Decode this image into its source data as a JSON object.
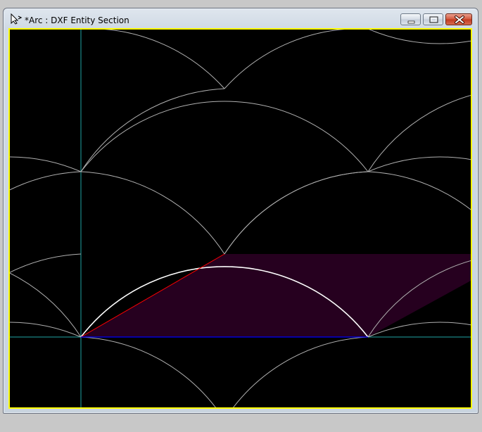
{
  "window": {
    "title": "*Arc : DXF Entity Section"
  },
  "icons": {
    "app": "cursor-arrow-icon",
    "minimize": "minimize-icon",
    "maximize": "maximize-icon",
    "close": "close-icon"
  },
  "colors": {
    "canvas_background": "#000000",
    "canvas_border": "#ffff00",
    "grid_arcs": "#b0b0b0",
    "highlight_arc": "#ffffff",
    "axis_lines": "#1fa3a3",
    "selection_fill": "#26001f",
    "chord_line": "#ff0000",
    "baseline": "#0000ff"
  }
}
